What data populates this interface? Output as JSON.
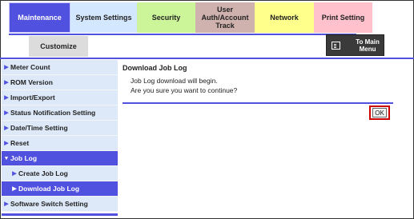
{
  "tabs": [
    {
      "label": "Maintenance"
    },
    {
      "label": "System Settings"
    },
    {
      "label": "Security"
    },
    {
      "label": "User Auth/Account Track"
    },
    {
      "label": "Network"
    },
    {
      "label": "Print Setting"
    }
  ],
  "customize_label": "Customize",
  "main_menu_label": "To Main Menu",
  "sidebar": {
    "items": [
      {
        "label": "Meter Count"
      },
      {
        "label": "ROM Version"
      },
      {
        "label": "Import/Export"
      },
      {
        "label": "Status Notification Setting"
      },
      {
        "label": "Date/Time Setting"
      },
      {
        "label": "Reset"
      },
      {
        "label": "Job Log"
      },
      {
        "label": "Create Job Log"
      },
      {
        "label": "Download Job Log"
      },
      {
        "label": "Software Switch Setting"
      }
    ]
  },
  "content": {
    "title": "Download Job Log",
    "line1": "Job Log download will begin.",
    "line2": "Are you sure you want to continue?",
    "ok_label": "OK"
  },
  "colors": {
    "accent": "#5151e0",
    "highlight": "#cc0000"
  }
}
